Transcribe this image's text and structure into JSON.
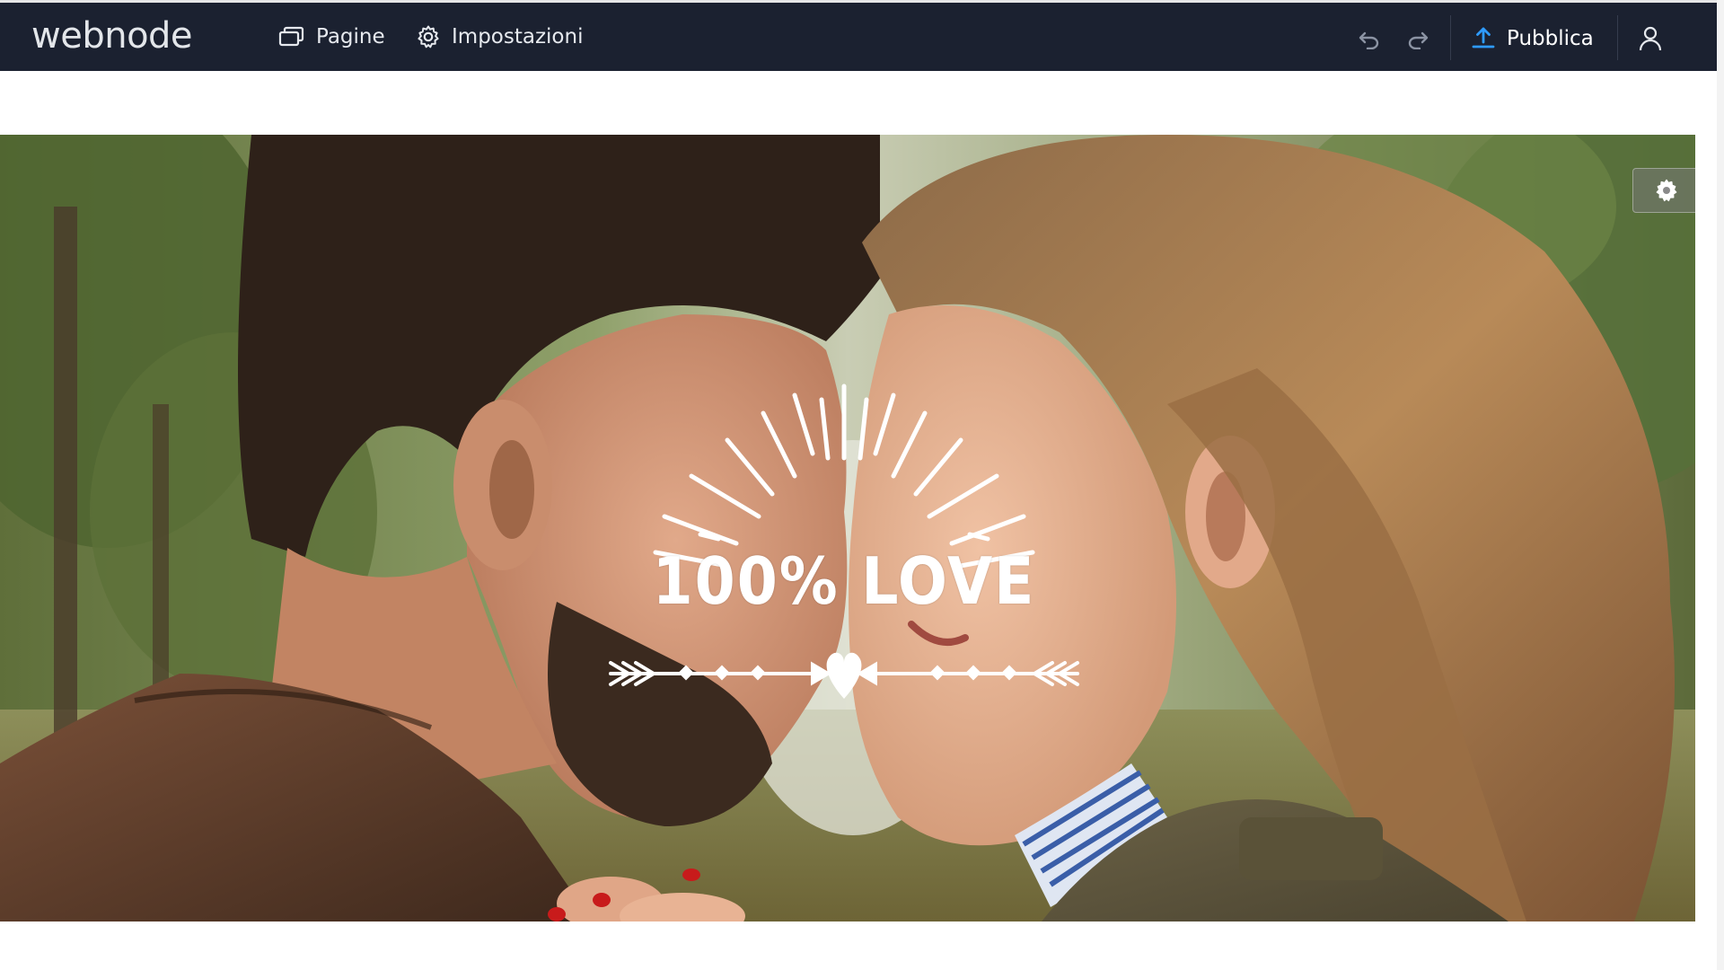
{
  "toolbar": {
    "logo": "webnode",
    "pages_label": "Pagine",
    "settings_label": "Impostazioni",
    "publish_label": "Pubblica",
    "background_color": "#1b2130",
    "accent_color": "#2e9bff"
  },
  "icons": {
    "pages": "pages-stack-icon",
    "settings": "gear-icon",
    "undo": "undo-icon",
    "redo": "redo-icon",
    "publish": "upload-icon",
    "account": "user-icon",
    "hero_settings": "gear-icon"
  },
  "hero": {
    "badge_text": "100% LOVE",
    "image_description_colors": {
      "foliage": "#6b7d45",
      "hair_man": "#3a2a1f",
      "hair_woman": "#a97a4b",
      "jacket": "#5a3d2a"
    }
  }
}
